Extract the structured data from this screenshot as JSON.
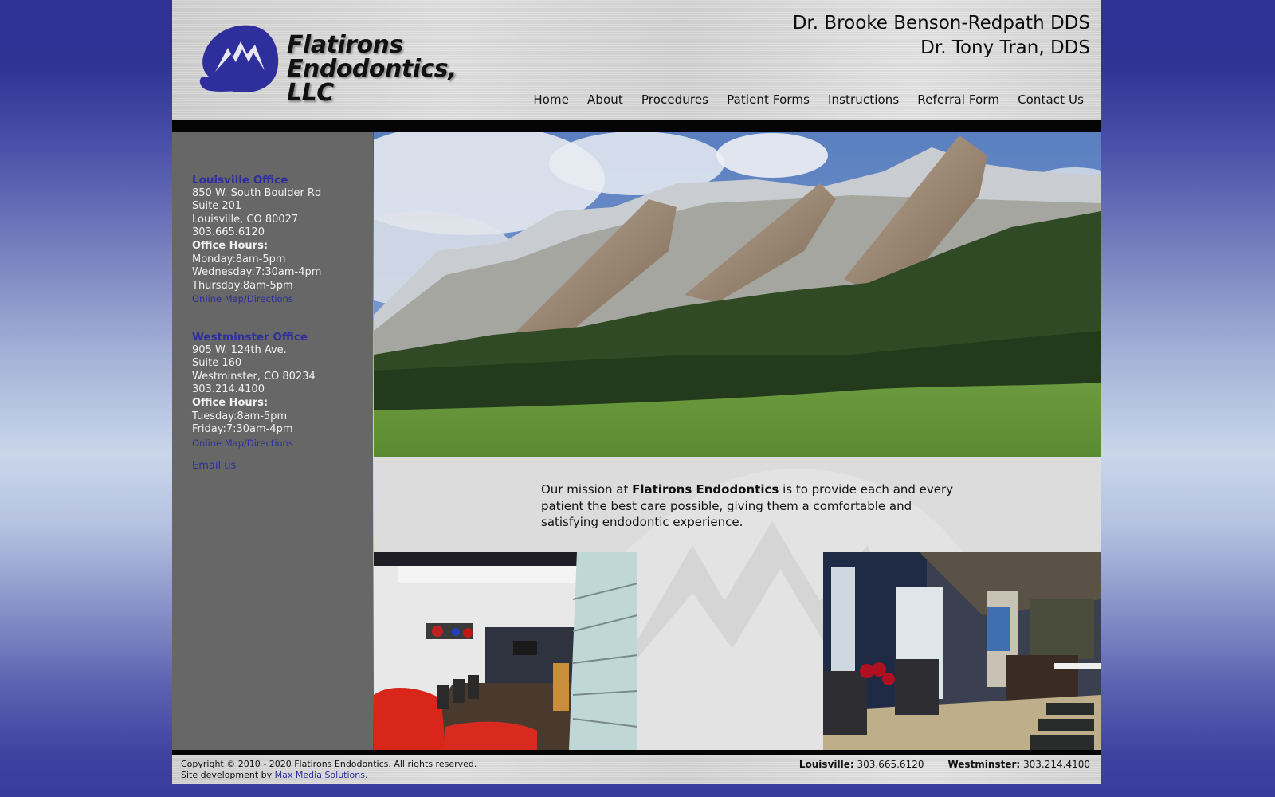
{
  "brand": {
    "line1": "Flatirons",
    "line2": "Endodontics, LLC",
    "accent_color": "#2e2f9c"
  },
  "doctors": [
    "Dr. Brooke Benson-Redpath DDS",
    "Dr. Tony Tran, DDS"
  ],
  "nav": {
    "items": [
      {
        "label": "Home"
      },
      {
        "label": "About"
      },
      {
        "label": "Procedures"
      },
      {
        "label": "Patient Forms"
      },
      {
        "label": "Instructions"
      },
      {
        "label": "Referral Form"
      },
      {
        "label": "Contact Us"
      }
    ]
  },
  "sidebar": {
    "offices": [
      {
        "title": "Louisville Office",
        "address1": "850 W. South Boulder Rd",
        "address2": "Suite 201",
        "city": "Louisville, CO 80027",
        "phone": "303.665.6120",
        "hours_label": "Office Hours:",
        "hours": [
          "Monday:8am-5pm",
          "Wednesday:7:30am-4pm",
          "Thursday:8am-5pm"
        ],
        "map_link": "Online Map/Directions"
      },
      {
        "title": "Westminster Office",
        "address1": "905 W. 124th Ave.",
        "address2": "Suite 160",
        "city": "Westminster, CO 80234",
        "phone": "303.214.4100",
        "hours_label": "Office Hours:",
        "hours": [
          "Tuesday:8am-5pm",
          "Friday:7:30am-4pm"
        ],
        "map_link": "Online Map/Directions"
      }
    ],
    "email_link": "Email us"
  },
  "hero": {
    "alt": "Flatirons mountains landscape"
  },
  "mission": {
    "prefix": "Our mission at ",
    "bold": "Flatirons Endodontics",
    "suffix": " is to provide each and every patient the best care possible, giving them a comfortable and satisfying endodontic experience."
  },
  "photos": {
    "left_alt": "Louisville office waiting room",
    "right_alt": "Westminster office reception"
  },
  "footer": {
    "copyright": "Copyright © 2010 - 2020 Flatirons Endodontics. All rights reserved.",
    "dev_prefix": "Site development by ",
    "dev_link": "Max Media Solutions",
    "dev_suffix": ".",
    "phones": [
      {
        "label": "Louisville:",
        "value": " 303.665.6120"
      },
      {
        "label": "Westminster:",
        "value": " 303.214.4100"
      }
    ]
  }
}
